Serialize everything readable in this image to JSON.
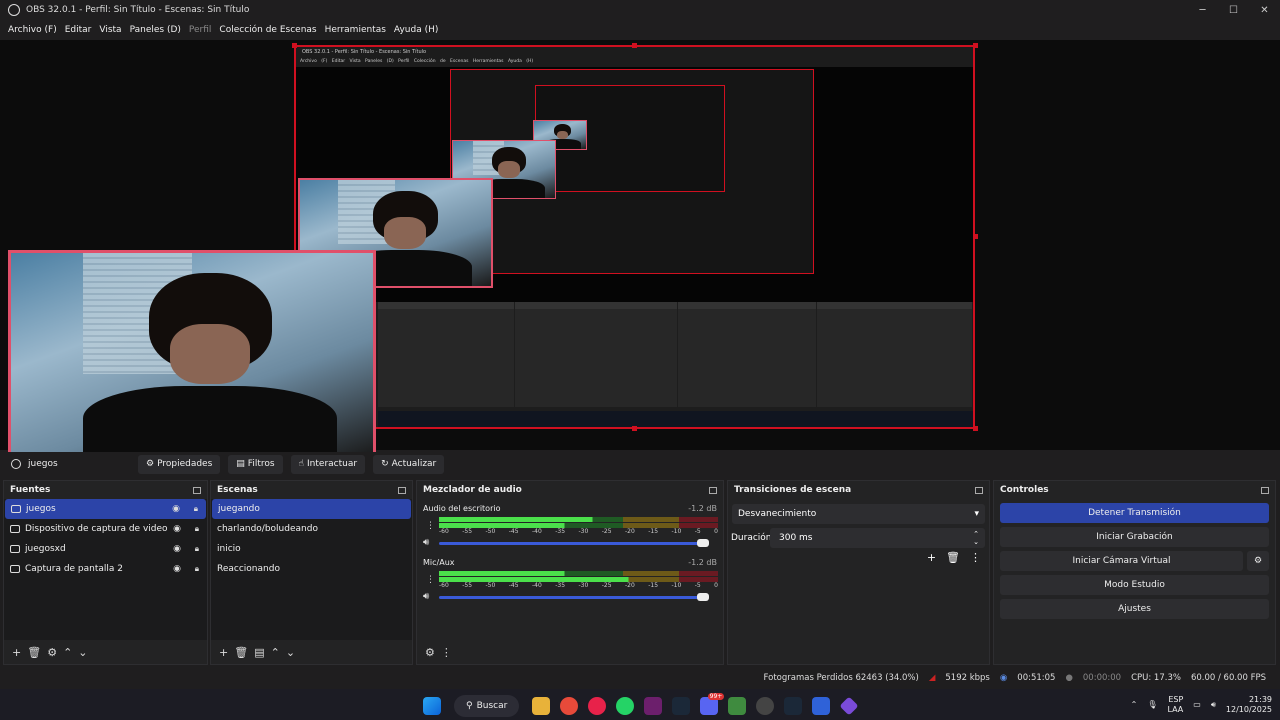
{
  "window": {
    "title": "OBS 32.0.1 - Perfil: Sin Título - Escenas: Sin Título"
  },
  "menu": [
    {
      "label": "Archivo (F)",
      "disabled": false
    },
    {
      "label": "Editar",
      "disabled": false
    },
    {
      "label": "Vista",
      "disabled": false
    },
    {
      "label": "Paneles (D)",
      "disabled": false
    },
    {
      "label": "Perfil",
      "disabled": true
    },
    {
      "label": "Colección de Escenas",
      "disabled": false
    },
    {
      "label": "Herramientas",
      "disabled": false
    },
    {
      "label": "Ayuda (H)",
      "disabled": false
    }
  ],
  "preview": {
    "inner_title": "OBS 32.0.1 - Perfil: Sin Título - Escenas: Sin Título",
    "inner_menu": "Archivo (F) Editar Vista Paneles (D) Perfil Colección de Escenas Herramientas Ayuda (H)"
  },
  "source_toolbar": {
    "source_name": "juegos",
    "properties": "Propiedades",
    "filters": "Filtros",
    "interact": "Interactuar",
    "refresh": "Actualizar"
  },
  "sources": {
    "title": "Fuentes",
    "items": [
      {
        "label": "juegos",
        "icon": "camera-icon",
        "selected": true
      },
      {
        "label": "Dispositivo de captura de video",
        "icon": "camera-icon",
        "selected": false
      },
      {
        "label": "juegosxd",
        "icon": "monitor-icon",
        "selected": false
      },
      {
        "label": "Captura de pantalla 2",
        "icon": "monitor-icon",
        "selected": false
      }
    ]
  },
  "scenes": {
    "title": "Escenas",
    "items": [
      {
        "label": "juegando",
        "selected": true
      },
      {
        "label": "charlando/boludeando",
        "selected": false
      },
      {
        "label": "inicio",
        "selected": false
      },
      {
        "label": "Reaccionando",
        "selected": false
      }
    ]
  },
  "mixer": {
    "title": "Mezclador de audio",
    "scale": [
      "-60",
      "-55",
      "-50",
      "-45",
      "-40",
      "-35",
      "-30",
      "-25",
      "-20",
      "-15",
      "-10",
      "-5",
      "0"
    ],
    "channels": [
      {
        "name": "Audio del escritorio",
        "db": "-1.2 dB",
        "level": 0.55,
        "level2": 0.45
      },
      {
        "name": "Mic/Aux",
        "db": "-1.2 dB",
        "level": 0.45,
        "level2": 0.68
      }
    ]
  },
  "transitions": {
    "title": "Transiciones de escena",
    "selected": "Desvanecimiento",
    "duration_label": "Duración",
    "duration_value": "300 ms"
  },
  "controls": {
    "title": "Controles",
    "stop_stream": "Detener Transmisión",
    "start_record": "Iniciar Grabación",
    "virtual_cam": "Iniciar Cámara Virtual",
    "studio_mode": "Modo Estudio",
    "settings": "Ajustes"
  },
  "status": {
    "dropped": "Fotogramas Perdidos 62463 (34.0%)",
    "bitrate": "5192 kbps",
    "stream_time": "00:51:05",
    "rec_time": "00:00:00",
    "cpu": "CPU: 17.3%",
    "fps": "60.00 / 60.00 FPS"
  },
  "taskbar": {
    "search": "Buscar",
    "lang": "ESP",
    "lang2": "LAA",
    "time": "21:39",
    "date": "12/10/2025",
    "badge": "99+"
  },
  "colors": {
    "accent": "#2c44a8",
    "selection_border": "#d01020",
    "webcam_border": "#e0506a"
  }
}
